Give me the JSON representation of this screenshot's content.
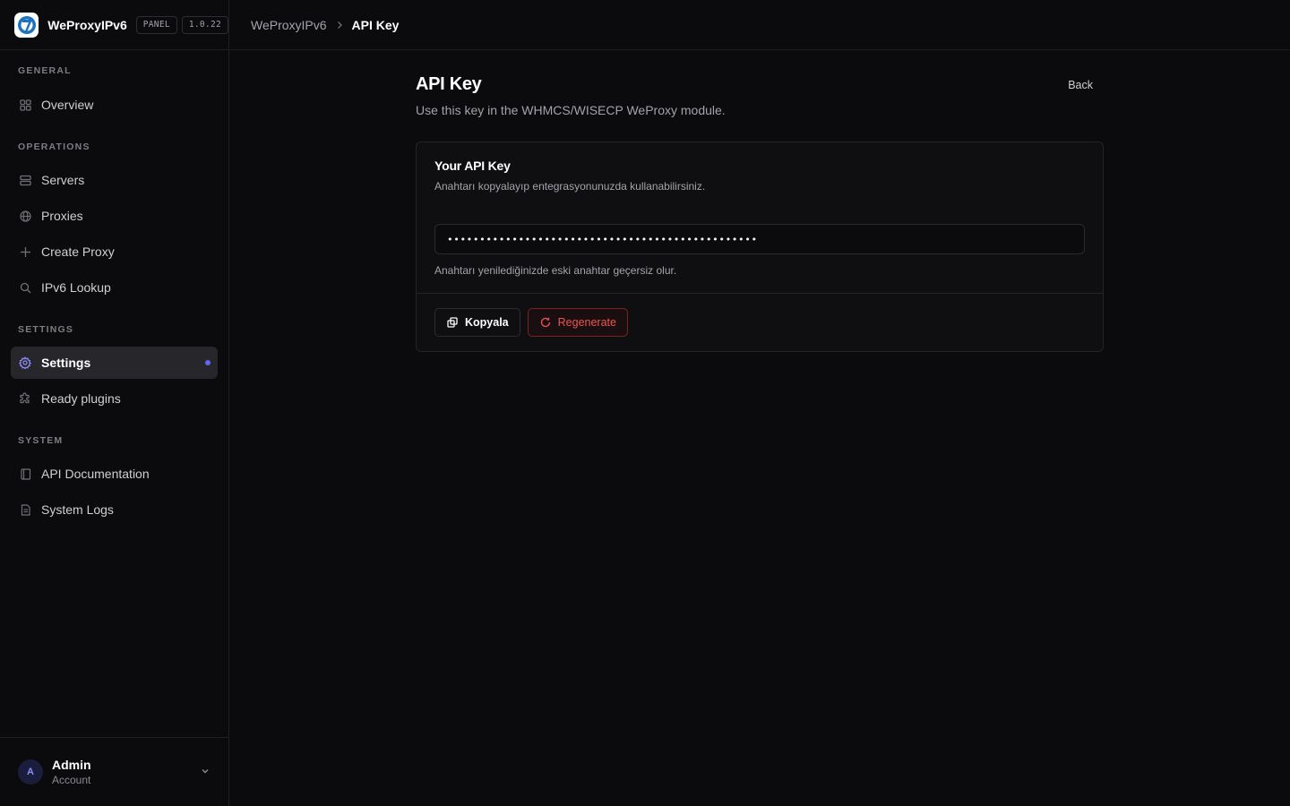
{
  "brand": {
    "name": "WeProxyIPv6",
    "panel_badge": "PANEL",
    "version_badge": "1.0.22"
  },
  "sidebar": {
    "sections": [
      {
        "title": "GENERAL",
        "items": [
          {
            "label": "Overview",
            "icon": "grid-icon"
          }
        ]
      },
      {
        "title": "OPERATIONS",
        "items": [
          {
            "label": "Servers",
            "icon": "server-icon"
          },
          {
            "label": "Proxies",
            "icon": "globe-icon"
          },
          {
            "label": "Create Proxy",
            "icon": "plus-icon"
          },
          {
            "label": "IPv6 Lookup",
            "icon": "search-icon"
          }
        ]
      },
      {
        "title": "SETTINGS",
        "items": [
          {
            "label": "Settings",
            "icon": "gear-icon",
            "active": true
          },
          {
            "label": "Ready plugins",
            "icon": "puzzle-icon"
          }
        ]
      },
      {
        "title": "SYSTEM",
        "items": [
          {
            "label": "API Documentation",
            "icon": "book-icon"
          },
          {
            "label": "System Logs",
            "icon": "file-text-icon"
          }
        ]
      }
    ]
  },
  "account": {
    "initial": "A",
    "name": "Admin",
    "role": "Account"
  },
  "breadcrumb": {
    "root": "WeProxyIPv6",
    "current": "API Key"
  },
  "page": {
    "title": "API Key",
    "subtitle": "Use this key in the WHMCS/WISECP WeProxy module.",
    "back_label": "Back"
  },
  "card": {
    "title": "Your API Key",
    "description": "Anahtarı kopyalayıp entegrasyonunuzda kullanabilirsiniz.",
    "masked_key": "••••••••••••••••••••••••••••••••••••••••••••••••",
    "hint": "Anahtarı yenilediğinizde eski anahtar geçersiz olur.",
    "copy_label": "Kopyala",
    "regenerate_label": "Regenerate"
  },
  "colors": {
    "accent": "#6366f1",
    "danger": "#f05252",
    "background": "#0b0b0d"
  }
}
